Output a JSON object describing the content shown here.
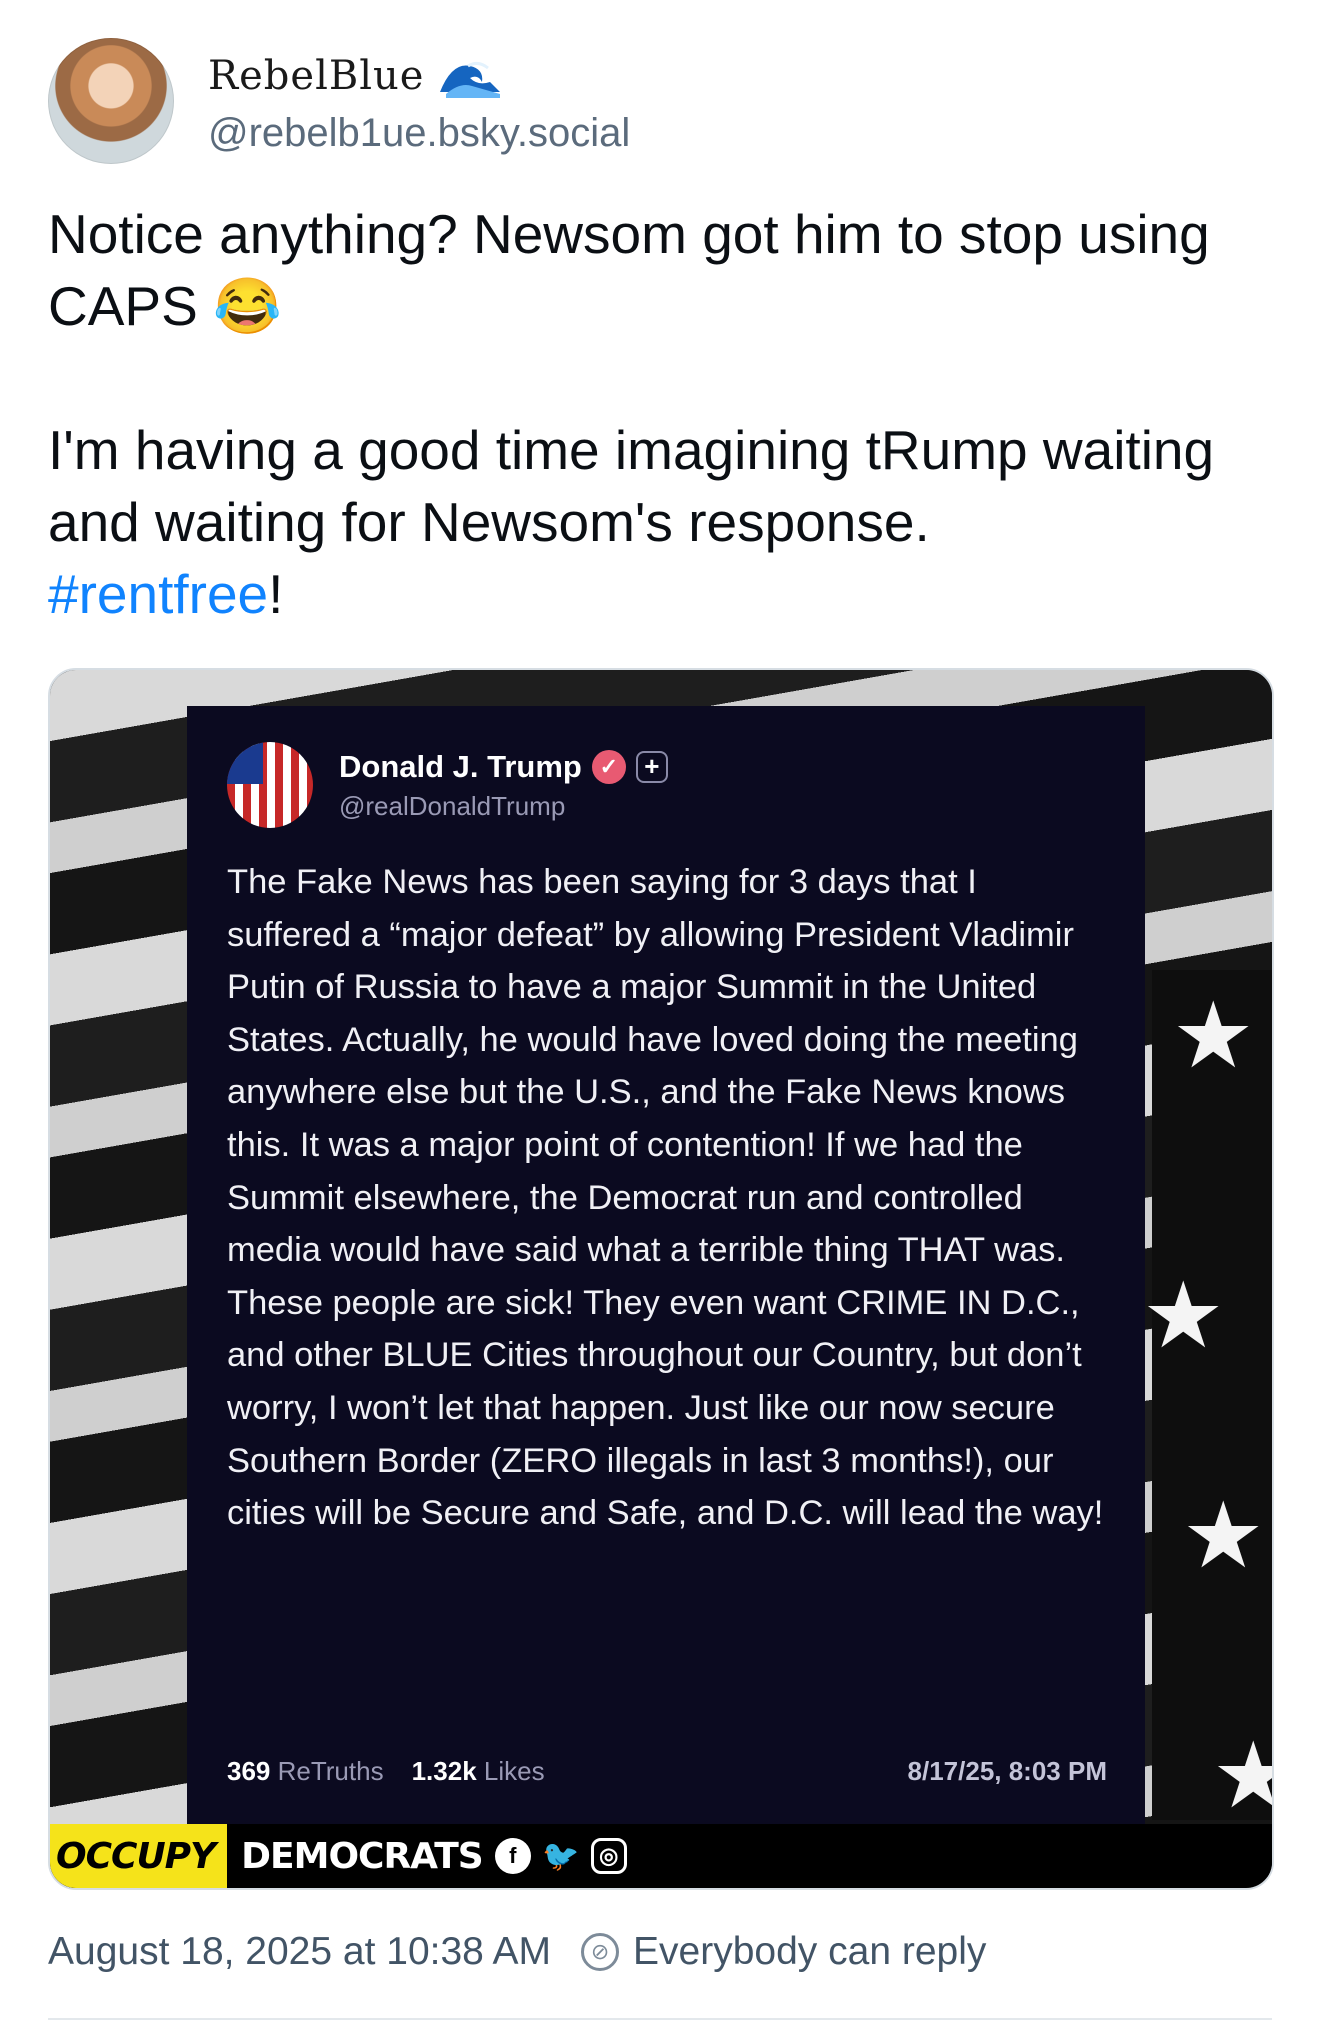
{
  "author": {
    "display_name": "RebelBlue",
    "emoji": "🌊",
    "handle": "@rebelb1ue.bsky.social"
  },
  "post": {
    "line1": "Notice anything? Newsom got him to stop using CAPS 😂",
    "line2": "I'm having a good time imagining tRump waiting and waiting for Newsom's response.",
    "hashtag": "#rentfree",
    "hashtag_suffix": "!"
  },
  "embed": {
    "truth": {
      "name": "Donald J. Trump",
      "handle": "@realDonaldTrump",
      "body": "The Fake News has been saying for 3 days that I suffered a “major defeat” by allowing President Vladimir Putin of Russia to have a major Summit in the United States. Actually, he would have loved doing the meeting anywhere else but the U.S., and the Fake News knows this. It was a major point of contention! If we had the Summit elsewhere, the Democrat run and controlled media would have said what a terrible thing THAT was. These people are sick! They even want CRIME IN D.C., and other BLUE Cities throughout our Country, but don’t worry, I won’t let that happen. Just like our now secure Southern Border (ZERO illegals in last 3 months!), our cities will be Secure and Safe, and D.C. will lead the way!",
      "retruths_count": "369",
      "retruths_label": "ReTruths",
      "likes_count": "1.32k",
      "likes_label": "Likes",
      "date": "8/17/25, 8:03 PM"
    },
    "brand": {
      "occupy": "OCCUPY",
      "democrats": "DEMOCRATS",
      "icons": [
        "facebook-icon",
        "twitter-icon",
        "instagram-icon"
      ]
    }
  },
  "footer": {
    "timestamp": "August 18, 2025 at 10:38 AM",
    "reply_setting": "Everybody can reply"
  },
  "colors": {
    "hashtag": "#1083fe",
    "card_bg": "#0b0a20",
    "brand_yellow": "#f5e31a"
  }
}
